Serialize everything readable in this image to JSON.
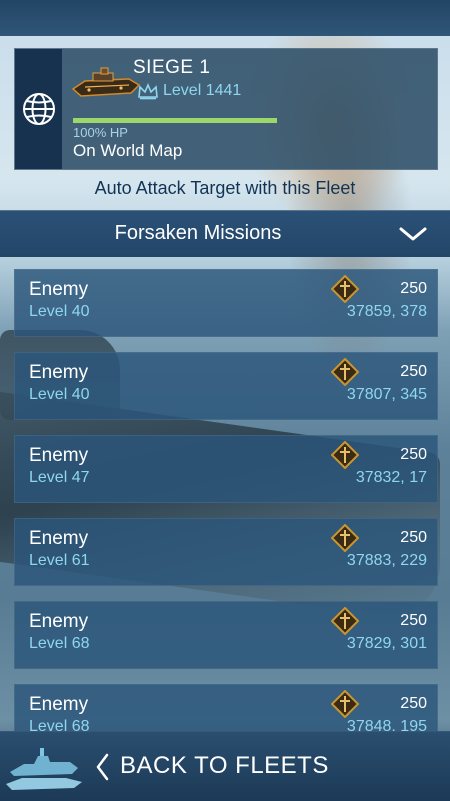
{
  "fleet": {
    "name": "SIEGE 1",
    "level": "Level 1441",
    "hp_text": "100% HP",
    "hp_fraction": 1.0,
    "location": "On World Map",
    "globe_icon": "globe-icon",
    "ship_icon": "battleship-icon"
  },
  "auto_attack_label": "Auto Attack Target with this Fleet",
  "mission_header": {
    "title": "Forsaken Missions",
    "toggle_icon": "chevron-down-icon"
  },
  "missions": [
    {
      "name": "Enemy",
      "level": "Level 40",
      "power": "250",
      "coords": "37859, 378"
    },
    {
      "name": "Enemy",
      "level": "Level 40",
      "power": "250",
      "coords": "37807, 345"
    },
    {
      "name": "Enemy",
      "level": "Level 47",
      "power": "250",
      "coords": "37832, 17"
    },
    {
      "name": "Enemy",
      "level": "Level 61",
      "power": "250",
      "coords": "37883, 229"
    },
    {
      "name": "Enemy",
      "level": "Level 68",
      "power": "250",
      "coords": "37829, 301"
    },
    {
      "name": "Enemy",
      "level": "Level 68",
      "power": "250",
      "coords": "37848, 195"
    }
  ],
  "bottom_bar": {
    "back_label": "BACK TO FLEETS",
    "back_icon": "chevron-left-icon",
    "logo_icon": "fleet-logo-icon"
  },
  "colors": {
    "accent_cyan": "#8fd6ee",
    "hp_green": "#9cd76b",
    "emblem_gold": "#c9962f"
  }
}
